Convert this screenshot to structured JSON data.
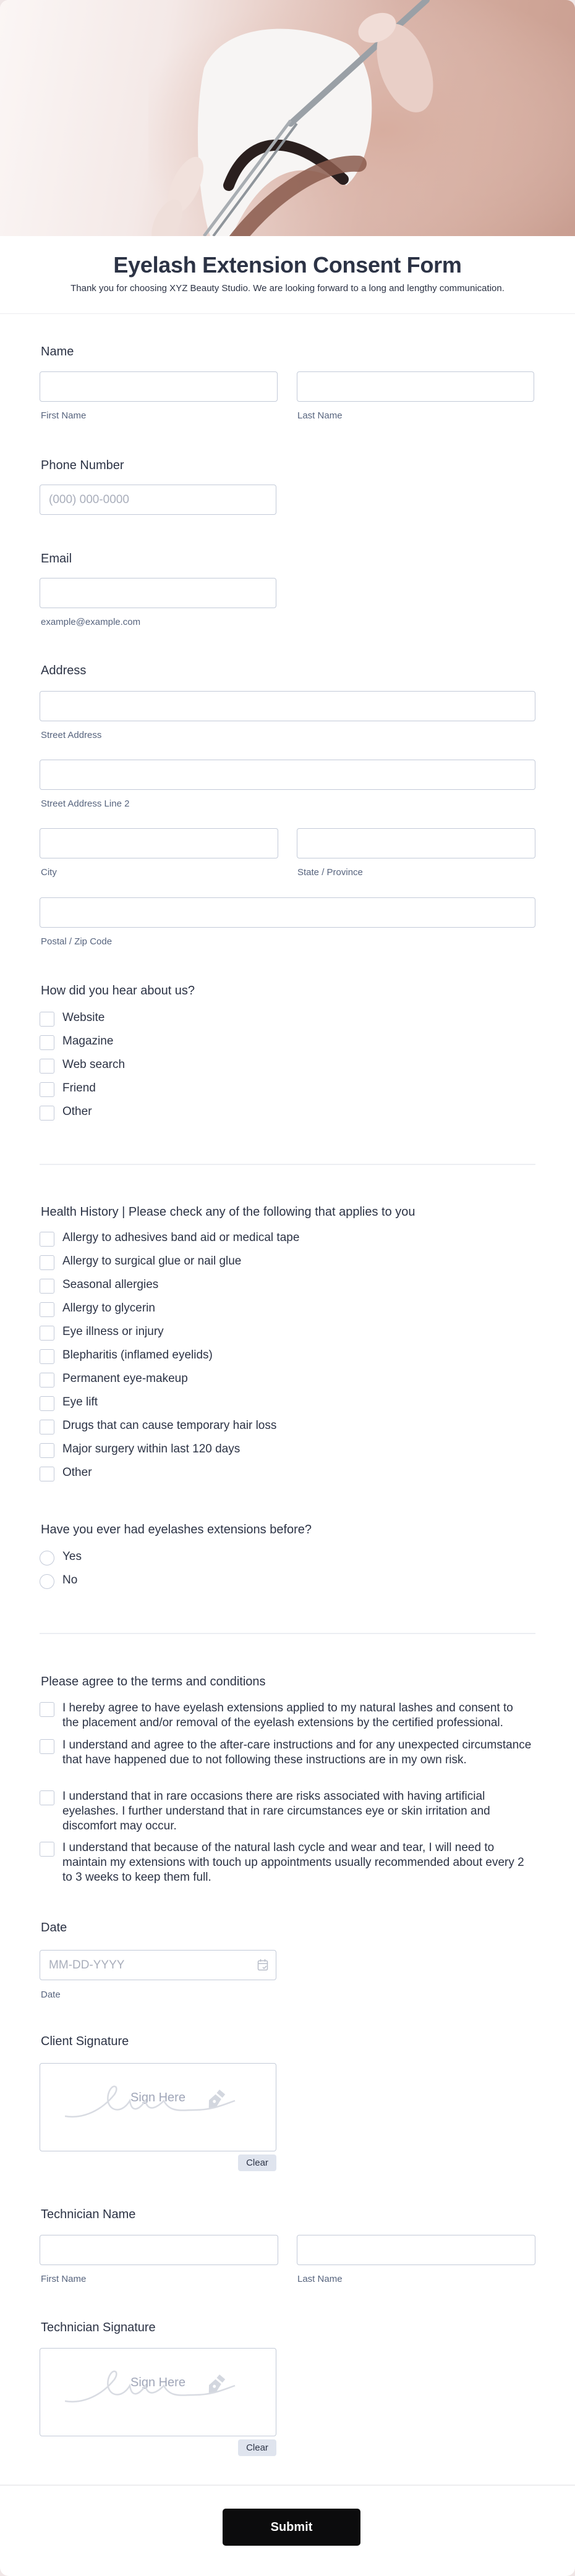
{
  "header": {
    "title": "Eyelash Extension Consent Form",
    "subtitle": "Thank you for choosing XYZ Beauty Studio. We are looking forward to a long and lengthy communication."
  },
  "name": {
    "label": "Name",
    "first_value": "",
    "last_value": "",
    "first_sublabel": "First Name",
    "last_sublabel": "Last Name"
  },
  "phone": {
    "label": "Phone Number",
    "placeholder": "(000) 000-0000"
  },
  "email": {
    "label": "Email",
    "value": "",
    "sublabel": "example@example.com"
  },
  "address": {
    "label": "Address",
    "street_sublabel": "Street Address",
    "street2_sublabel": "Street Address Line 2",
    "city_sublabel": "City",
    "state_sublabel": "State / Province",
    "zip_sublabel": "Postal / Zip Code"
  },
  "hear_about": {
    "label": "How did you hear about us?",
    "options": [
      "Website",
      "Magazine",
      "Web search",
      "Friend",
      "Other"
    ]
  },
  "health_history": {
    "label": "Health History | Please check any of the following that applies to you",
    "options": [
      "Allergy to adhesives band aid or medical tape",
      "Allergy to surgical glue or nail glue",
      "Seasonal allergies",
      "Allergy to glycerin",
      "Eye illness or injury",
      "Blepharitis (inflamed eyelids)",
      "Permanent eye-makeup",
      "Eye lift",
      "Drugs that can cause temporary hair loss",
      "Major surgery within last 120 days",
      "Other"
    ]
  },
  "previous_extensions": {
    "label": "Have you ever had eyelashes extensions before?",
    "options": [
      "Yes",
      "No"
    ]
  },
  "terms": {
    "label": "Please agree to the terms and conditions",
    "options": [
      "I hereby agree to have eyelash extensions applied to my natural lashes and consent to the placement and/or removal of the eyelash extensions by the certified professional.",
      "I understand and agree to the after-care instructions and for any unexpected circumstance that have happened due to not following these instructions are in my own risk.",
      "I understand that in rare occasions there are risks associated with having artificial eyelashes. I further understand that in rare circumstances eye or skin irritation and discomfort may occur.",
      "I understand that because of the natural lash cycle and wear and tear, I will need to maintain my extensions with touch up appointments usually recommended about every 2 to 3 weeks to keep them full."
    ]
  },
  "date": {
    "label": "Date",
    "placeholder": "MM-DD-YYYY",
    "sublabel": "Date",
    "icon": "calendar-icon"
  },
  "client_signature": {
    "label": "Client Signature",
    "placeholder": "Sign Here",
    "clear_label": "Clear"
  },
  "technician_name": {
    "label": "Technician Name",
    "first_sublabel": "First Name",
    "last_sublabel": "Last Name"
  },
  "technician_signature": {
    "label": "Technician Signature",
    "placeholder": "Sign Here",
    "clear_label": "Clear"
  },
  "submit_label": "Submit"
}
